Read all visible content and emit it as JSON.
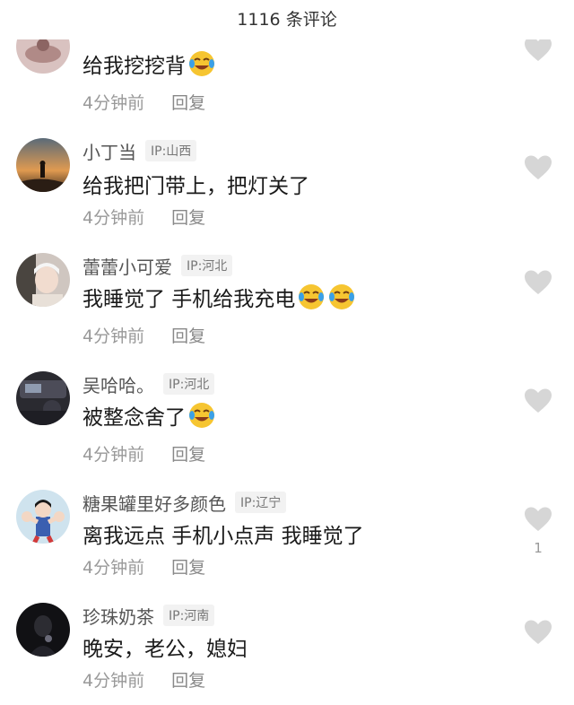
{
  "header": {
    "title": "1116 条评论"
  },
  "comments": [
    {
      "name": "",
      "ip": "",
      "text": "给我挖挖背",
      "emoji_count": 1,
      "time": "4分钟前",
      "reply": "回复",
      "likes": ""
    },
    {
      "name": "小丁当",
      "ip": "IP:山西",
      "text": "给我把门带上，把灯关了",
      "emoji_count": 0,
      "time": "4分钟前",
      "reply": "回复",
      "likes": ""
    },
    {
      "name": "蕾蕾小可爱",
      "ip": "IP:河北",
      "text": "我睡觉了 手机给我充电",
      "emoji_count": 2,
      "time": "4分钟前",
      "reply": "回复",
      "likes": ""
    },
    {
      "name": "吴哈哈。",
      "ip": "IP:河北",
      "text": "被整念舍了",
      "emoji_count": 1,
      "time": "4分钟前",
      "reply": "回复",
      "likes": ""
    },
    {
      "name": "糖果罐里好多颜色",
      "ip": "IP:辽宁",
      "text": "离我远点 手机小点声 我睡觉了",
      "emoji_count": 0,
      "time": "4分钟前",
      "reply": "回复",
      "likes": "1"
    },
    {
      "name": "珍珠奶茶",
      "ip": "IP:河南",
      "text": "晚安，老公，媳妇",
      "emoji_count": 0,
      "time": "4分钟前",
      "reply": "回复",
      "likes": ""
    }
  ],
  "icons": {
    "like": "heart-icon",
    "emoji": "tears-of-joy-emoji",
    "like_color": "#d6d6d6",
    "emoji_color": "#f6c531",
    "tear_color": "#3aa0e8"
  }
}
